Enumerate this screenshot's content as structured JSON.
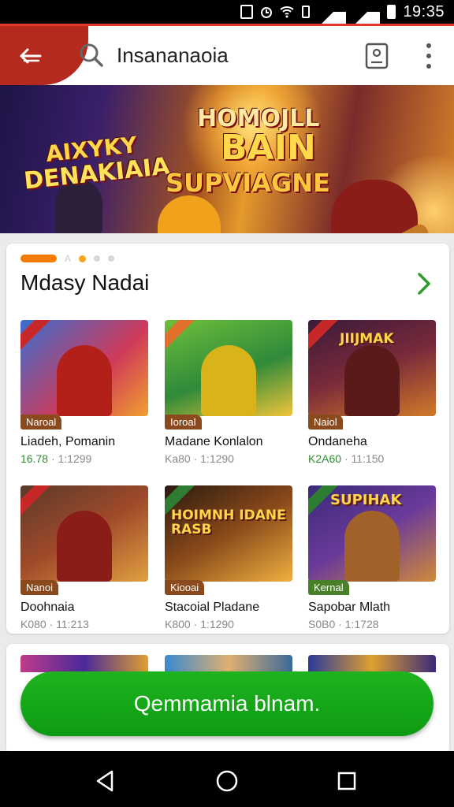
{
  "status_bar": {
    "time": "19:35",
    "icons": [
      "notification-icon",
      "alarm-icon",
      "wifi-icon",
      "vibrate-icon",
      "signal-icon",
      "signal-icon",
      "battery-icon"
    ]
  },
  "app_bar": {
    "back_icon": "back-arrow-icon",
    "search_icon": "search-icon",
    "search_text": "Insananaoia",
    "account_icon": "account-card-icon",
    "more_icon": "more-vert-icon",
    "accent_color": "#e23a2a"
  },
  "banner": {
    "line1": "AIXYKY",
    "line2": "DENAKIAIA",
    "line3": "HOMOJLL",
    "line4": "BAIN",
    "line5": "SUPVIAGNE"
  },
  "section": {
    "title": "Mdasy Nadai",
    "arrow_icon": "chevron-right-icon",
    "pager_label": "A",
    "games": [
      {
        "badge": "Naroal",
        "name": "Liadeh, Pomanin",
        "rating": "16.78",
        "meta": "· 1:1299",
        "thumb_word": ""
      },
      {
        "badge": "Ioroal",
        "name": "Madane Konlalon",
        "rating": "",
        "meta": "Ka80 · 1:1290",
        "thumb_word": ""
      },
      {
        "badge": "Naiol",
        "name": "Ondaneha",
        "rating": "K2A60",
        "meta": "· 11:150",
        "thumb_word": "JIIJMAK"
      },
      {
        "badge": "Nanoi",
        "name": "Doohnaia",
        "rating": "",
        "meta": "K080 · 11:213",
        "thumb_word": ""
      },
      {
        "badge": "Kiooai",
        "name": "Stacoial Pladane",
        "rating": "",
        "meta": "K800 · 1:1290",
        "thumb_word": "HOIMNH IDANE RASB"
      },
      {
        "badge": "Kernal",
        "name": "Sapobar Mlath",
        "rating": "",
        "meta": "S0B0 · 1:1728",
        "thumb_word": "SUPIHAK"
      }
    ]
  },
  "cta": {
    "label": "Qemmamia blnam."
  },
  "nav_bar": {
    "icons": [
      "nav-back-icon",
      "nav-home-icon",
      "nav-recents-icon"
    ]
  }
}
